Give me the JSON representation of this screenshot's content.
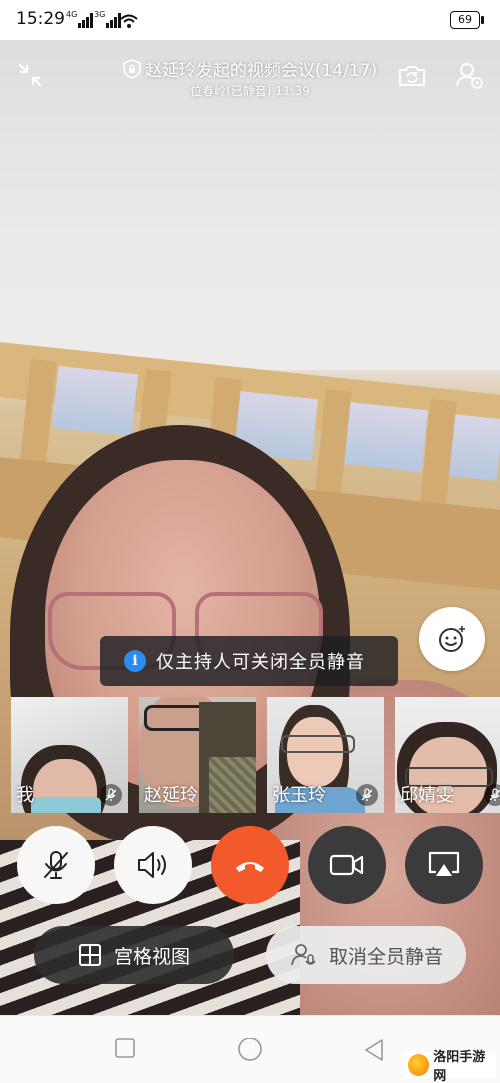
{
  "status_bar": {
    "time": "15:29",
    "signal_1_label": "4G",
    "signal_2_label": "3G",
    "battery": "69"
  },
  "header": {
    "title": "赵延玲发起的视频会议(14/17)",
    "subtitle": "位春岭(已静音) 11:39",
    "left_icon": "minimize-icon",
    "title_icon": "shield-lock-icon",
    "right_icons": [
      "switch-camera-icon",
      "members-icon"
    ]
  },
  "toast": {
    "text": "仅主持人可关闭全员静音",
    "icon": "info-icon"
  },
  "participants": [
    {
      "name": "我",
      "muted": true
    },
    {
      "name": "赵延玲",
      "muted": false
    },
    {
      "name": "张玉玲",
      "muted": true
    },
    {
      "name": "邱婧雯",
      "muted": true
    }
  ],
  "controls": [
    "mic-muted-icon",
    "speaker-icon",
    "hang-up-icon",
    "camera-icon",
    "screen-share-icon"
  ],
  "actions": {
    "grid_view_label": "宫格视图",
    "unmute_all_label": "取消全员静音"
  },
  "watermark": "洛阳手游网",
  "colors": {
    "hang_up": "#f25a2c",
    "info": "#2a8cf0",
    "toast_bg": "#1e1e23"
  }
}
